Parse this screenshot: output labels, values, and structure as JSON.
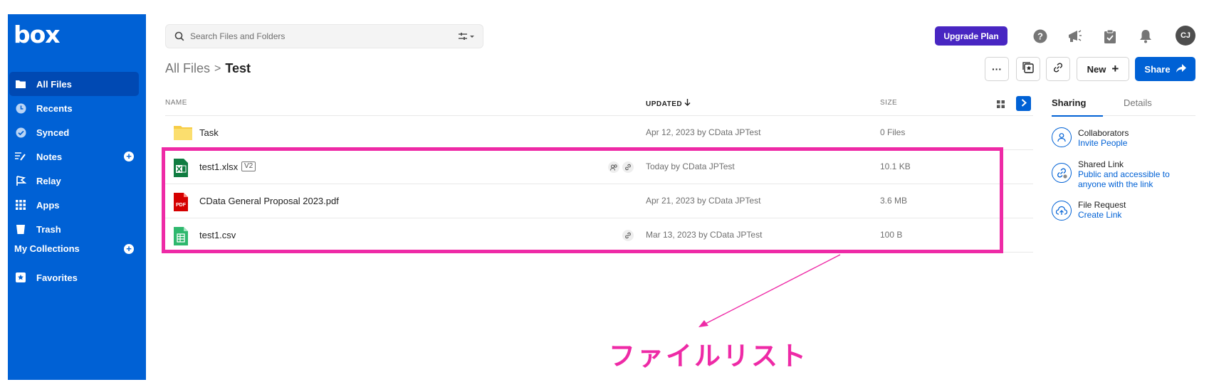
{
  "sidebar": {
    "logo": "box",
    "items": [
      {
        "label": "All Files",
        "icon": "folder-icon"
      },
      {
        "label": "Recents",
        "icon": "clock-icon"
      },
      {
        "label": "Synced",
        "icon": "check-circle-icon"
      },
      {
        "label": "Notes",
        "icon": "notes-icon"
      },
      {
        "label": "Relay",
        "icon": "relay-icon"
      },
      {
        "label": "Apps",
        "icon": "apps-grid-icon"
      },
      {
        "label": "Trash",
        "icon": "trash-icon"
      }
    ],
    "collections_label": "My Collections",
    "favorites_label": "Favorites"
  },
  "header": {
    "search_placeholder": "Search Files and Folders",
    "upgrade_label": "Upgrade Plan",
    "avatar_initials": "CJ"
  },
  "breadcrumb": {
    "root": "All Files",
    "separator": ">",
    "current": "Test"
  },
  "toolbar": {
    "more_label": "···",
    "new_label": "New",
    "share_label": "Share"
  },
  "file_list": {
    "columns": {
      "name": "NAME",
      "updated": "UPDATED",
      "size": "SIZE"
    },
    "rows": [
      {
        "name": "Task",
        "type": "folder",
        "updated": "Apr 12, 2023 by CData JPTest",
        "size": "0 Files"
      },
      {
        "name": "test1.xlsx",
        "type": "xlsx",
        "version": "V2",
        "updated": "Today by CData JPTest",
        "size": "10.1 KB"
      },
      {
        "name": "CData General Proposal 2023.pdf",
        "type": "pdf",
        "updated": "Apr 21, 2023 by CData JPTest",
        "size": "3.6 MB"
      },
      {
        "name": "test1.csv",
        "type": "csv",
        "updated": "Mar 13, 2023 by CData JPTest",
        "size": "100 B"
      }
    ]
  },
  "right_panel": {
    "tabs": [
      "Sharing",
      "Details"
    ],
    "collaborators": {
      "title": "Collaborators",
      "link": "Invite People"
    },
    "shared_link": {
      "title": "Shared Link",
      "link": "Public and accessible to anyone with the link"
    },
    "file_request": {
      "title": "File Request",
      "link": "Create Link"
    }
  },
  "annotation": {
    "label": "ファイルリスト",
    "color": "#ee2aa6"
  },
  "colors": {
    "brand_blue": "#0061d5",
    "upgrade_purple": "#4826c2",
    "highlight_pink": "#ee2aa6"
  }
}
